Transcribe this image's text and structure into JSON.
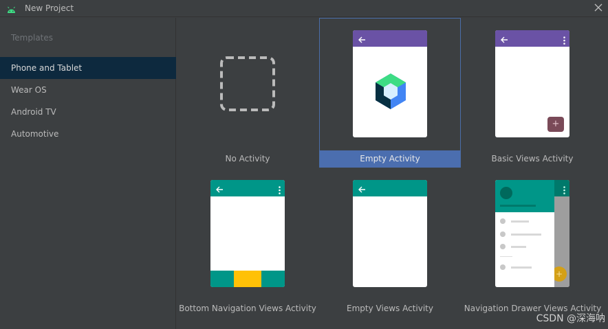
{
  "window": {
    "title": "New Project",
    "logo_icon": "android-icon",
    "close_icon": "close-icon"
  },
  "sidebar": {
    "heading": "Templates",
    "items": [
      {
        "label": "Phone and Tablet",
        "selected": true
      },
      {
        "label": "Wear OS",
        "selected": false
      },
      {
        "label": "Android TV",
        "selected": false
      },
      {
        "label": "Automotive",
        "selected": false
      }
    ]
  },
  "templates": [
    {
      "label": "No Activity",
      "selected": false
    },
    {
      "label": "Empty Activity",
      "selected": true
    },
    {
      "label": "Basic Views Activity",
      "selected": false
    },
    {
      "label": "Bottom Navigation Views Activity",
      "selected": false
    },
    {
      "label": "Empty Views Activity",
      "selected": false
    },
    {
      "label": "Navigation Drawer Views Activity",
      "selected": false
    }
  ],
  "fab_glyph": "+",
  "watermark": "CSDN @深海呐",
  "colors": {
    "background": "#3c3f41",
    "selected_sidebar": "#0d293e",
    "selected_card": "#4b6eaf",
    "purple_appbar": "#6a52a5",
    "teal_appbar": "#009688",
    "bottom_nav_active": "#ffc107"
  }
}
